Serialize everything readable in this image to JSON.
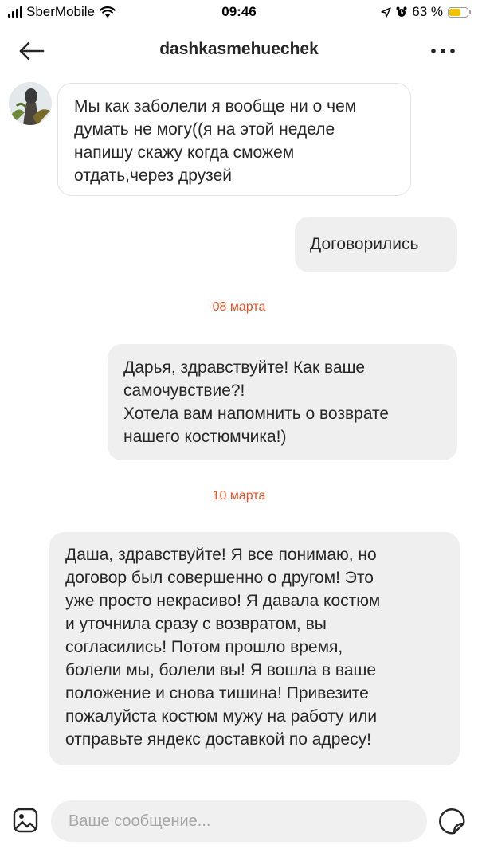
{
  "status_bar": {
    "carrier": "SberMobile",
    "time": "09:46",
    "battery": "63 %",
    "battery_level": 0.63
  },
  "header": {
    "title": "dashkasmehuechek",
    "back_icon": "arrow-left-icon",
    "more_icon": "more-horizontal-icon"
  },
  "conversation": {
    "messages": [
      {
        "direction": "incoming",
        "text": "Мы как заболели я вообще ни о чем\nдумать не могу((я на этой неделе\nнапишу скажу когда сможем\nотдать,через друзей"
      },
      {
        "direction": "outgoing",
        "text": "Договорились"
      },
      {
        "type": "date",
        "text": "08 марта"
      },
      {
        "direction": "outgoing",
        "text": "Дарья, здравствуйте! Как ваше\nсамочувствие?!\nХотела вам напомнить о возврате\nнашего костюмчика!)"
      },
      {
        "type": "date",
        "text": "10 марта"
      },
      {
        "direction": "outgoing",
        "text": "Даша, здравствуйте! Я все понимаю, но\nдоговор был совершенно о другом! Это\nуже просто некрасиво! Я давала костюм\nи уточнила сразу с возвратом, вы\nсогласились! Потом прошло время,\nболели мы, болели вы! Я вошла в ваше\nположение и снова тишина! Привезите\nпожалуйста костюм мужу на работу или\nотправьте яндекс доставкой по адресу!"
      }
    ]
  },
  "composer": {
    "placeholder": "Ваше сообщение...",
    "value": "",
    "gallery_icon": "image-gallery-icon",
    "sticker_icon": "sticker-icon"
  },
  "colors": {
    "date_separator": "#e4552a",
    "outgoing_bubble": "#efefef",
    "incoming_border": "#e3e3e3",
    "input_background": "#f0f0f0",
    "battery_fill": "#f2c200"
  }
}
